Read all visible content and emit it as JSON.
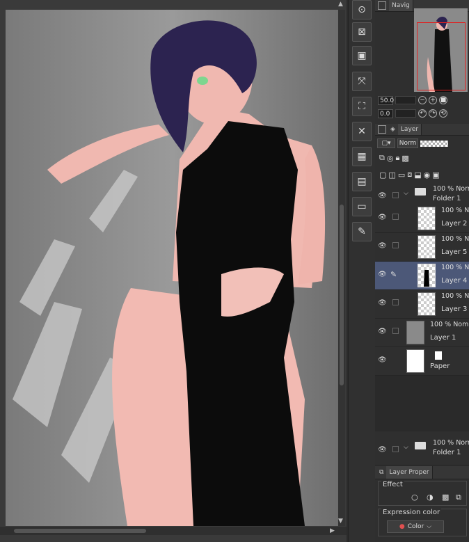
{
  "navigator": {
    "tab_label": "Navig",
    "zoom_value": "50.0",
    "rotation_value": "0.0"
  },
  "layer_panel": {
    "tab_label": "Layer",
    "blend_mode": "Norm",
    "layers": [
      {
        "mode": "100 % Norm",
        "name": "Folder 1",
        "type": "folder"
      },
      {
        "mode": "100 % No",
        "name": "Layer 2",
        "type": "layer"
      },
      {
        "mode": "100 % No",
        "name": "Layer 5",
        "type": "layer"
      },
      {
        "mode": "100 % N",
        "name": "Layer 4",
        "type": "layer",
        "selected": true
      },
      {
        "mode": "100 % N",
        "name": "Layer 3",
        "type": "layer"
      },
      {
        "mode": "100 % Nom",
        "name": "Layer 1",
        "type": "layer"
      },
      {
        "mode": "",
        "name": "Paper",
        "type": "paper"
      }
    ],
    "bottom_folder": {
      "mode": "100 % Norm",
      "name": "Folder 1"
    }
  },
  "layer_property": {
    "tab_label": "Layer Proper",
    "effect_label": "Effect",
    "expression_color_label": "Expression color",
    "color_dropdown": "Color"
  },
  "colors": {
    "selection_highlight": "#4c5878",
    "navigator_frame": "#e02020"
  }
}
